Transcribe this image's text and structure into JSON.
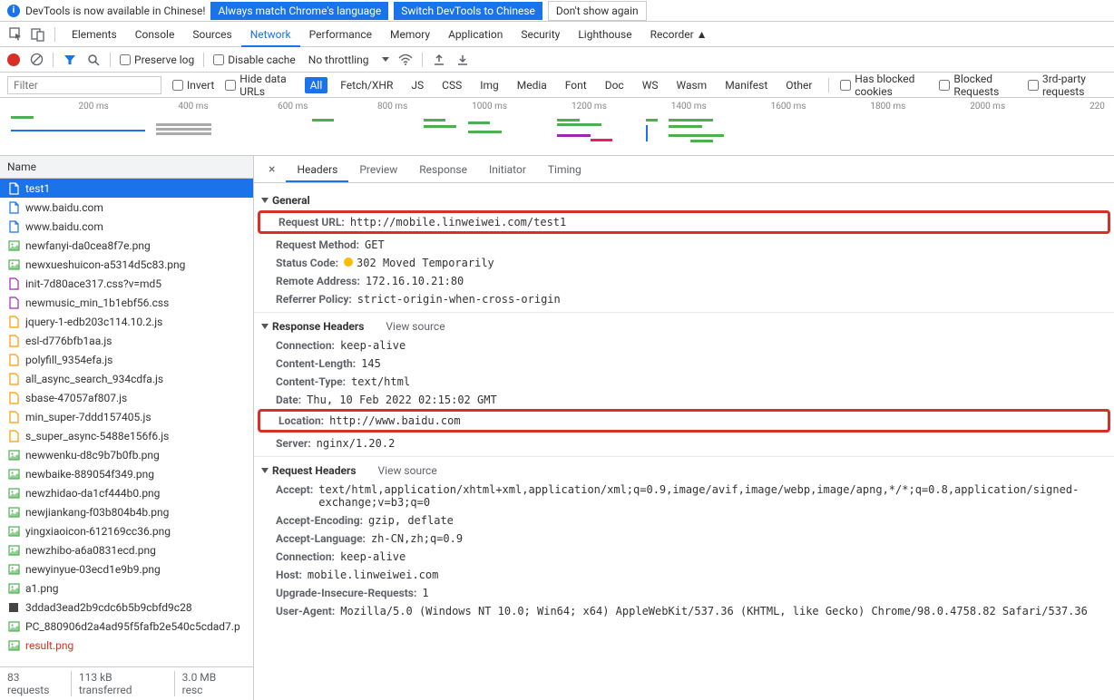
{
  "banner": {
    "text": "DevTools is now available in Chinese!",
    "btn1": "Always match Chrome's language",
    "btn2": "Switch DevTools to Chinese",
    "btn3": "Don't show again"
  },
  "main_tabs": [
    "Elements",
    "Console",
    "Sources",
    "Network",
    "Performance",
    "Memory",
    "Application",
    "Security",
    "Lighthouse",
    "Recorder ▲"
  ],
  "main_tab_active": 3,
  "toolbar": {
    "preserve": "Preserve log",
    "disable_cache": "Disable cache",
    "throttling": "No throttling"
  },
  "filter": {
    "placeholder": "Filter",
    "invert": "Invert",
    "hide_data": "Hide data URLs",
    "chips": [
      "All",
      "Fetch/XHR",
      "JS",
      "CSS",
      "Img",
      "Media",
      "Font",
      "Doc",
      "WS",
      "Wasm",
      "Manifest",
      "Other"
    ],
    "chip_active": 0,
    "blocked_cookies": "Has blocked cookies",
    "blocked_requests": "Blocked Requests",
    "third_party": "3rd-party requests"
  },
  "timeline_marks": [
    "200 ms",
    "400 ms",
    "600 ms",
    "800 ms",
    "1000 ms",
    "1200 ms",
    "1400 ms",
    "1600 ms",
    "1800 ms",
    "2000 ms",
    "220"
  ],
  "left": {
    "header": "Name",
    "rows": [
      {
        "name": "test1",
        "icon": "doc",
        "selected": true
      },
      {
        "name": "www.baidu.com",
        "icon": "doc"
      },
      {
        "name": "www.baidu.com",
        "icon": "doc"
      },
      {
        "name": "newfanyi-da0cea8f7e.png",
        "icon": "img"
      },
      {
        "name": "newxueshuicon-a5314d5c83.png",
        "icon": "img"
      },
      {
        "name": "init-7d80ace317.css?v=md5",
        "icon": "css"
      },
      {
        "name": "newmusic_min_1b1ebf56.css",
        "icon": "css"
      },
      {
        "name": "jquery-1-edb203c114.10.2.js",
        "icon": "js"
      },
      {
        "name": "esl-d776bfb1aa.js",
        "icon": "js"
      },
      {
        "name": "polyfill_9354efa.js",
        "icon": "js"
      },
      {
        "name": "all_async_search_934cdfa.js",
        "icon": "js"
      },
      {
        "name": "sbase-47057af807.js",
        "icon": "js"
      },
      {
        "name": "min_super-7ddd157405.js",
        "icon": "js"
      },
      {
        "name": "s_super_async-5488e156f6.js",
        "icon": "js"
      },
      {
        "name": "newwenku-d8c9b7b0fb.png",
        "icon": "img"
      },
      {
        "name": "newbaike-889054f349.png",
        "icon": "img"
      },
      {
        "name": "newzhidao-da1cf444b0.png",
        "icon": "img"
      },
      {
        "name": "newjiankang-f03b804b4b.png",
        "icon": "img"
      },
      {
        "name": "yingxiaoicon-612169cc36.png",
        "icon": "img"
      },
      {
        "name": "newzhibo-a6a0831ecd.png",
        "icon": "img"
      },
      {
        "name": "newyinyue-03ecd1e9b9.png",
        "icon": "img"
      },
      {
        "name": "a1.png",
        "icon": "img"
      },
      {
        "name": "3ddad3ead2b9cdc6b5b9cbfd9c28",
        "icon": "dark"
      },
      {
        "name": "PC_880906d2a4ad95f5fafb2e540c5cdad7.p",
        "icon": "img"
      },
      {
        "name": "result.png",
        "icon": "img",
        "highlight": true
      }
    ],
    "status": [
      "83 requests",
      "113 kB transferred",
      "3.0 MB resc"
    ]
  },
  "detail_tabs": [
    "Headers",
    "Preview",
    "Response",
    "Initiator",
    "Timing"
  ],
  "detail_tab_active": 0,
  "headers": {
    "general_title": "General",
    "general": [
      {
        "k": "Request URL:",
        "v": "http://mobile.linweiwei.com/test1",
        "boxed": true
      },
      {
        "k": "Request Method:",
        "v": "GET"
      },
      {
        "k": "Status Code:",
        "v": "302 Moved Temporarily",
        "status": true
      },
      {
        "k": "Remote Address:",
        "v": "172.16.10.21:80"
      },
      {
        "k": "Referrer Policy:",
        "v": "strict-origin-when-cross-origin"
      }
    ],
    "response_title": "Response Headers",
    "view_source": "View source",
    "response": [
      {
        "k": "Connection:",
        "v": "keep-alive"
      },
      {
        "k": "Content-Length:",
        "v": "145"
      },
      {
        "k": "Content-Type:",
        "v": "text/html"
      },
      {
        "k": "Date:",
        "v": "Thu, 10 Feb 2022 02:15:02 GMT"
      },
      {
        "k": "Location:",
        "v": "http://www.baidu.com",
        "boxed": true
      },
      {
        "k": "Server:",
        "v": "nginx/1.20.2"
      }
    ],
    "request_title": "Request Headers",
    "request": [
      {
        "k": "Accept:",
        "v": "text/html,application/xhtml+xml,application/xml;q=0.9,image/avif,image/webp,image/apng,*/*;q=0.8,application/signed-exchange;v=b3;q=0"
      },
      {
        "k": "Accept-Encoding:",
        "v": "gzip, deflate"
      },
      {
        "k": "Accept-Language:",
        "v": "zh-CN,zh;q=0.9"
      },
      {
        "k": "Connection:",
        "v": "keep-alive"
      },
      {
        "k": "Host:",
        "v": "mobile.linweiwei.com"
      },
      {
        "k": "Upgrade-Insecure-Requests:",
        "v": "1"
      },
      {
        "k": "User-Agent:",
        "v": "Mozilla/5.0 (Windows NT 10.0; Win64; x64) AppleWebKit/537.36 (KHTML, like Gecko) Chrome/98.0.4758.82 Safari/537.36"
      }
    ]
  }
}
